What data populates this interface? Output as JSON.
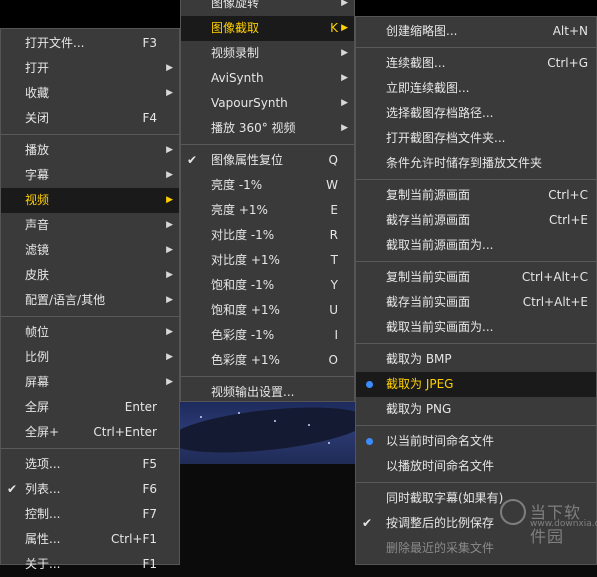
{
  "menu_main": {
    "items": [
      {
        "label": "打开文件...",
        "shortcut": "F3"
      },
      {
        "label": "打开",
        "arrow": "▶"
      },
      {
        "label": "收藏",
        "arrow": "▶"
      },
      {
        "label": "关闭",
        "shortcut": "F4"
      },
      {
        "label": "播放",
        "arrow": "▶"
      },
      {
        "label": "字幕",
        "arrow": "▶"
      },
      {
        "label": "视频",
        "arrow": "▶"
      },
      {
        "label": "声音",
        "arrow": "▶"
      },
      {
        "label": "滤镜",
        "arrow": "▶"
      },
      {
        "label": "皮肤",
        "arrow": "▶"
      },
      {
        "label": "配置/语言/其他",
        "arrow": "▶"
      },
      {
        "label": "帧位",
        "arrow": "▶"
      },
      {
        "label": "比例",
        "arrow": "▶"
      },
      {
        "label": "屏幕",
        "arrow": "▶"
      },
      {
        "label": "全屏",
        "shortcut": "Enter"
      },
      {
        "label": "全屏+",
        "shortcut": "Ctrl+Enter"
      },
      {
        "label": "选项...",
        "shortcut": "F5"
      },
      {
        "label": "列表...",
        "shortcut": "F6",
        "check": "✔"
      },
      {
        "label": "控制...",
        "shortcut": "F7"
      },
      {
        "label": "属性...",
        "shortcut": "Ctrl+F1"
      },
      {
        "label": "关于...",
        "shortcut": "F1"
      }
    ]
  },
  "menu_video": {
    "items": [
      {
        "label": "图像旋转",
        "arrow": "▶"
      },
      {
        "label": "图像截取",
        "shortcut": "K",
        "arrow": "▶"
      },
      {
        "label": "视频录制",
        "arrow": "▶"
      },
      {
        "label": "AviSynth",
        "arrow": "▶"
      },
      {
        "label": "VapourSynth",
        "arrow": "▶"
      },
      {
        "label": "播放 360° 视频",
        "arrow": "▶"
      },
      {
        "label": "图像属性复位",
        "shortcut": "Q",
        "check": "✔"
      },
      {
        "label": "亮度 -1%",
        "shortcut": "W"
      },
      {
        "label": "亮度 +1%",
        "shortcut": "E"
      },
      {
        "label": "对比度 -1%",
        "shortcut": "R"
      },
      {
        "label": "对比度 +1%",
        "shortcut": "T"
      },
      {
        "label": "饱和度 -1%",
        "shortcut": "Y"
      },
      {
        "label": "饱和度 +1%",
        "shortcut": "U"
      },
      {
        "label": "色彩度 -1%",
        "shortcut": "I"
      },
      {
        "label": "色彩度 +1%",
        "shortcut": "O"
      },
      {
        "label": "视频输出设置..."
      }
    ]
  },
  "menu_capture": {
    "items": [
      {
        "label": "创建缩略图...",
        "shortcut": "Alt+N"
      },
      {
        "label": "连续截图...",
        "shortcut": "Ctrl+G"
      },
      {
        "label": "立即连续截图..."
      },
      {
        "label": "选择截图存档路径..."
      },
      {
        "label": "打开截图存档文件夹..."
      },
      {
        "label": "条件允许时储存到播放文件夹"
      },
      {
        "label": "复制当前源画面",
        "shortcut": "Ctrl+C"
      },
      {
        "label": "截存当前源画面",
        "shortcut": "Ctrl+E"
      },
      {
        "label": "截取当前源画面为..."
      },
      {
        "label": "复制当前实画面",
        "shortcut": "Ctrl+Alt+C"
      },
      {
        "label": "截存当前实画面",
        "shortcut": "Ctrl+Alt+E"
      },
      {
        "label": "截取当前实画面为..."
      },
      {
        "label": "截取为 BMP"
      },
      {
        "label": "截取为 JPEG"
      },
      {
        "label": "截取为 PNG"
      },
      {
        "label": "以当前时间命名文件"
      },
      {
        "label": "以播放时间命名文件"
      },
      {
        "label": "同时截取字幕(如果有)"
      },
      {
        "label": "按调整后的比例保存",
        "check": "✔"
      },
      {
        "label": "删除最近的采集文件"
      }
    ]
  },
  "watermark": {
    "name": "当下软件园",
    "url": "www.downxia.com"
  },
  "colors": {
    "menu_bg": "#3a3a3a",
    "highlight_bg": "#1a1a1a",
    "highlight_text": "#ffd000",
    "radio": "#3b8dff"
  }
}
